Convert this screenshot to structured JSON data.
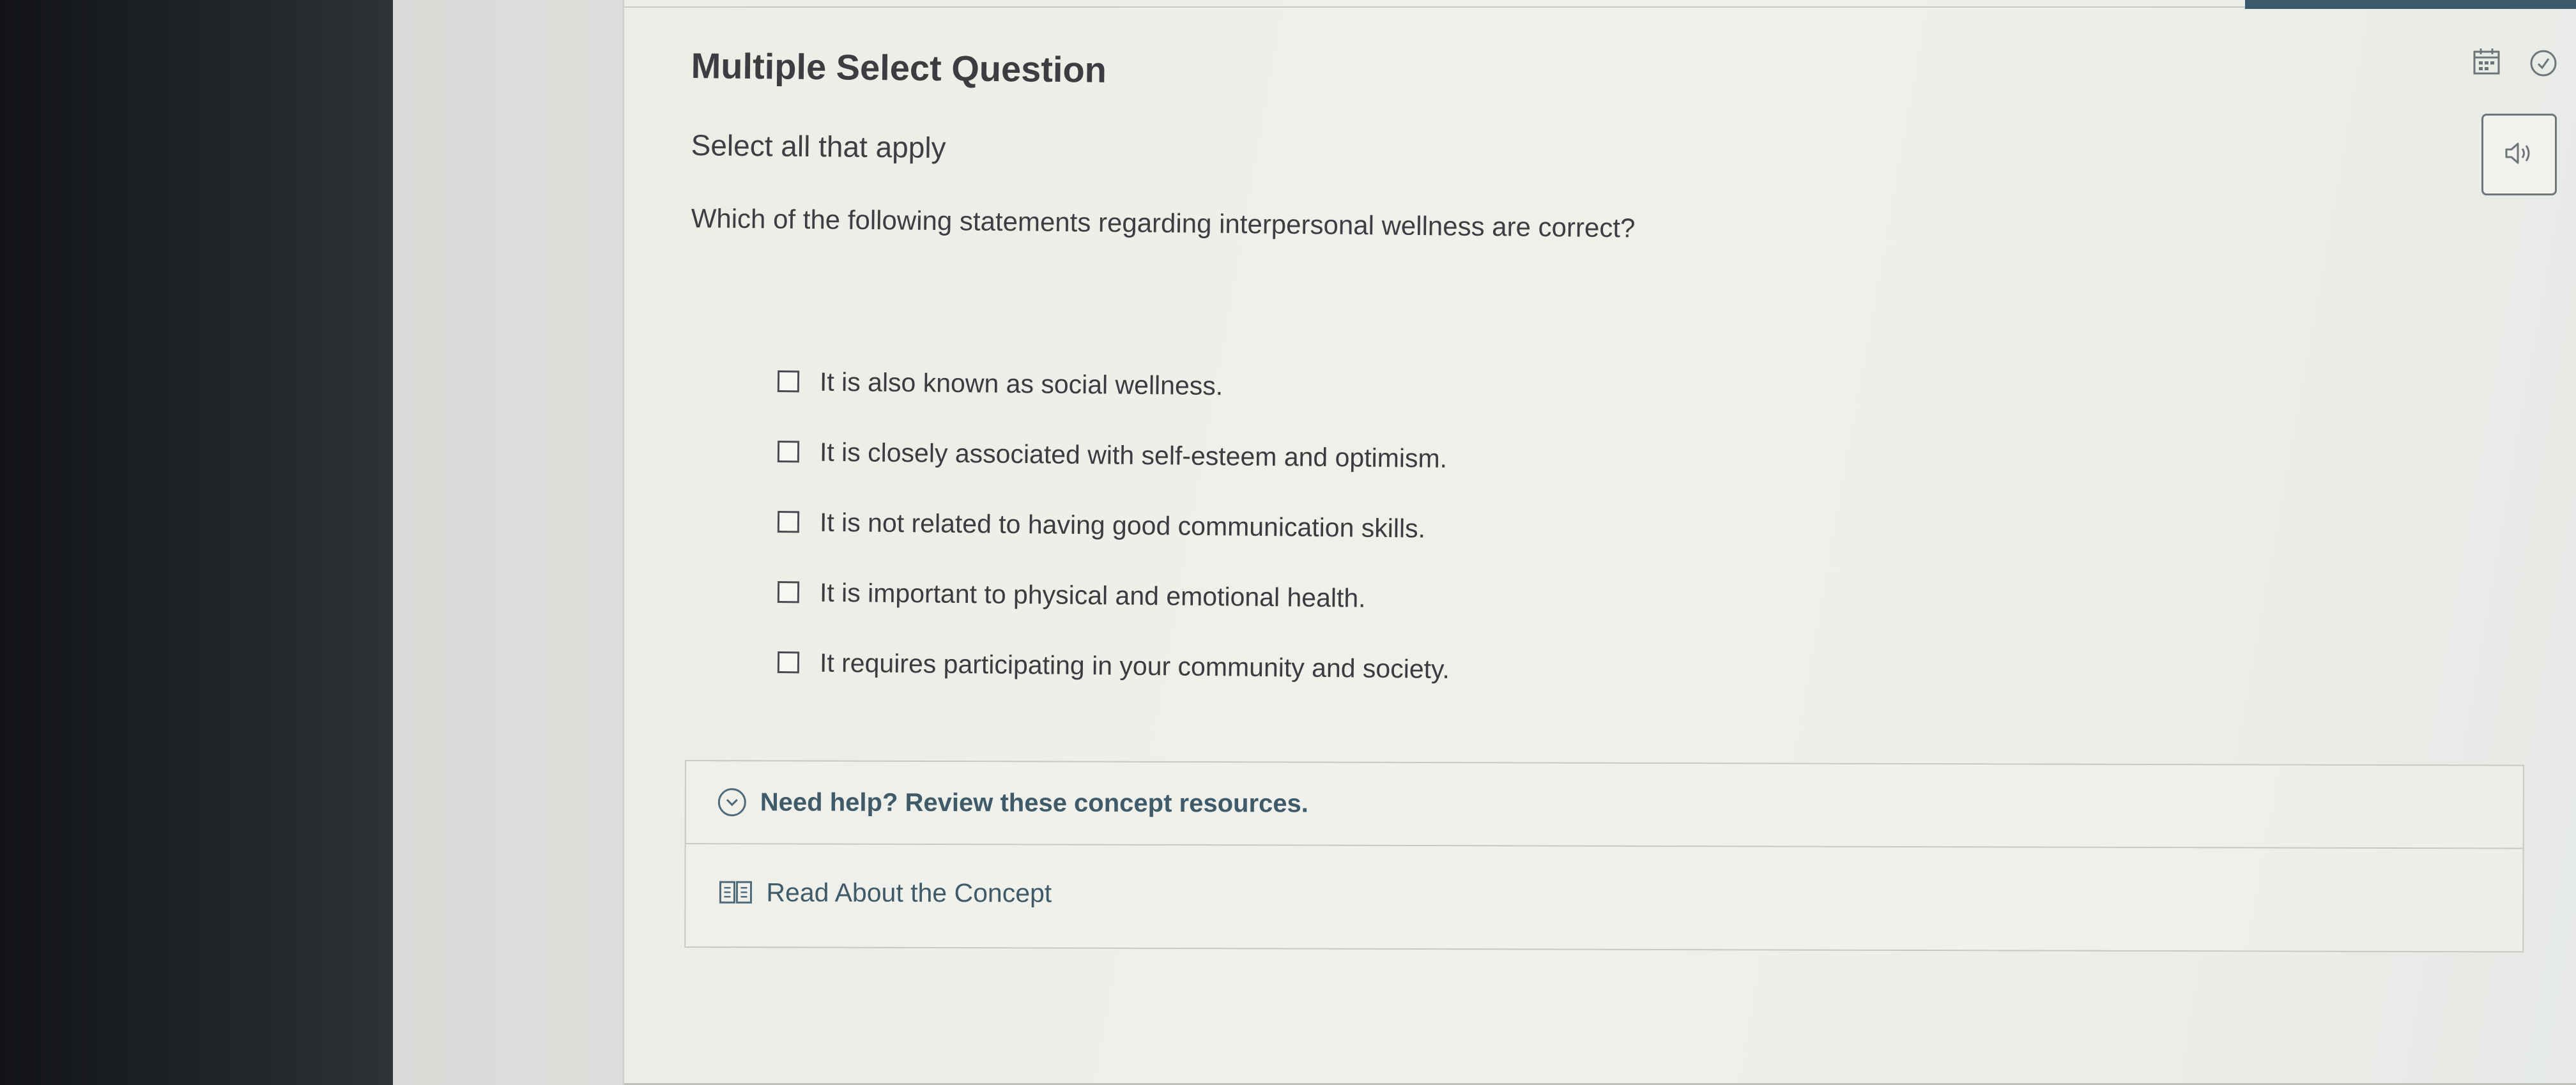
{
  "question": {
    "type_title": "Multiple Select Question",
    "instruction": "Select all that apply",
    "prompt": "Which of the following statements regarding interpersonal wellness are correct?",
    "options": [
      {
        "label": "It is also known as social wellness.",
        "checked": false
      },
      {
        "label": "It is closely associated with self-esteem and optimism.",
        "checked": false
      },
      {
        "label": "It is not related to having good communication skills.",
        "checked": false
      },
      {
        "label": "It is important to physical and emotional health.",
        "checked": false
      },
      {
        "label": "It requires participating in your community and society.",
        "checked": false
      }
    ]
  },
  "help": {
    "title": "Need help? Review these concept resources.",
    "resource_link": "Read About the Concept"
  },
  "icons": {
    "calendar": "calendar-icon",
    "check_circle": "check-circle-icon",
    "audio": "speaker-icon",
    "expand": "chevron-down-circle-icon",
    "book": "book-icon"
  },
  "colors": {
    "help_text": "#3f5a68",
    "body_text": "#3c3e41",
    "accent_bar": "#3c5a6b"
  }
}
